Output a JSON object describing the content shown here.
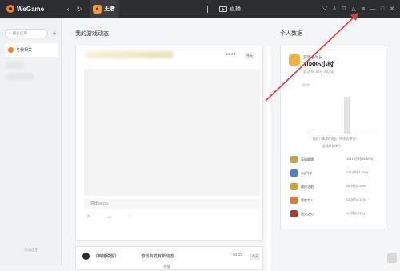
{
  "titlebar": {
    "logo_text": "WeGame",
    "back_icon": "‹",
    "refresh_icon": "↻",
    "game_tab_label": "王者",
    "live_tab_label": "直播",
    "icons": [
      "shield-icon",
      "person-icon",
      "bag-icon",
      "bell-icon",
      "menu-icon"
    ],
    "window_controls": [
      "—",
      "□",
      "✕"
    ]
  },
  "sidebar": {
    "search_placeholder": "搜索应用",
    "add_symbol": "+",
    "items": [
      {
        "label": "与我相关"
      }
    ],
    "footer_text": "添加应用"
  },
  "feed": {
    "heading": "我的游戏动态",
    "cards": [
      {
        "time": "04-23",
        "tag": "今天",
        "caption": "游戏04.23s"
      },
      {
        "title": "《英雄联盟》",
        "event": "游戏有发有新动态",
        "time": "04-23",
        "tag": "今天",
        "bottom_text": "热播"
      }
    ]
  },
  "profile": {
    "heading": "个人数据",
    "playtime_label": "游戏总时长",
    "playtime_value": "10885小时",
    "rank_text": "超过 56.61% 的玩家",
    "chart_data": {
      "type": "bar",
      "categories": [
        "最近八周游戏时长"
      ],
      "values": [
        1300
      ],
      "y_ticks": [
        "1512h",
        "",
        "",
        ""
      ],
      "xlabel": "最近八周游戏时长（每周为单位）",
      "ylim": [
        0,
        1512
      ]
    },
    "rank_title": "游戏时长排行",
    "games": [
      {
        "name": "英雄联盟",
        "hours": "10415小时(95.67%)",
        "color": "#c9a24a"
      },
      {
        "name": "QQ飞车",
        "hours": "427小时(3.92%)",
        "color": "#4d7cd6"
      },
      {
        "name": "最终之前",
        "hours": "28小时(0.26%)",
        "color": "#d9a02d"
      },
      {
        "name": "冒险岛2",
        "hours": "12小时(0.11%)",
        "color": "#e07a2a"
      },
      {
        "name": "洛克之刃",
        "hours": "1小时(0.01%)",
        "color": "#b7372c"
      }
    ]
  },
  "annotation": {
    "arrow_color": "#e23a3a"
  }
}
